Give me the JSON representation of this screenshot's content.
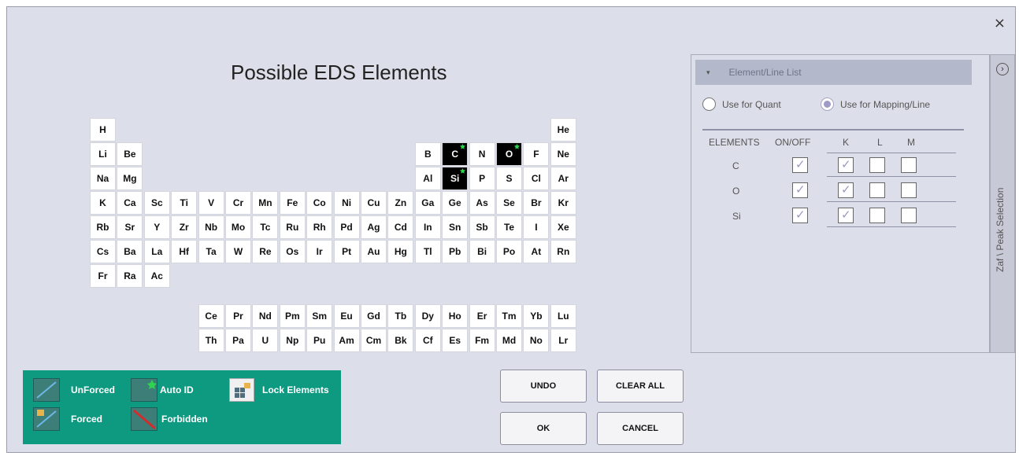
{
  "dialog": {
    "title": "Possible EDS Elements",
    "close_label": "×"
  },
  "periodic_table": {
    "rows": [
      [
        "H",
        "",
        "",
        "",
        "",
        "",
        "",
        "",
        "",
        "",
        "",
        "",
        "",
        "",
        "",
        "",
        "",
        "He"
      ],
      [
        "Li",
        "Be",
        "",
        "",
        "",
        "",
        "",
        "",
        "",
        "",
        "",
        "",
        "B",
        "C",
        "N",
        "O",
        "F",
        "Ne"
      ],
      [
        "Na",
        "Mg",
        "",
        "",
        "",
        "",
        "",
        "",
        "",
        "",
        "",
        "",
        "Al",
        "Si",
        "P",
        "S",
        "Cl",
        "Ar"
      ],
      [
        "K",
        "Ca",
        "Sc",
        "Ti",
        "V",
        "Cr",
        "Mn",
        "Fe",
        "Co",
        "Ni",
        "Cu",
        "Zn",
        "Ga",
        "Ge",
        "As",
        "Se",
        "Br",
        "Kr"
      ],
      [
        "Rb",
        "Sr",
        "Y",
        "Zr",
        "Nb",
        "Mo",
        "Tc",
        "Ru",
        "Rh",
        "Pd",
        "Ag",
        "Cd",
        "In",
        "Sn",
        "Sb",
        "Te",
        "I",
        "Xe"
      ],
      [
        "Cs",
        "Ba",
        "La",
        "Hf",
        "Ta",
        "W",
        "Re",
        "Os",
        "Ir",
        "Pt",
        "Au",
        "Hg",
        "Tl",
        "Pb",
        "Bi",
        "Po",
        "At",
        "Rn"
      ],
      [
        "Fr",
        "Ra",
        "Ac"
      ]
    ],
    "lanthanides": [
      "Ce",
      "Pr",
      "Nd",
      "Pm",
      "Sm",
      "Eu",
      "Gd",
      "Tb",
      "Dy",
      "Ho",
      "Er",
      "Tm",
      "Yb",
      "Lu"
    ],
    "actinides": [
      "Th",
      "Pa",
      "U",
      "Np",
      "Pu",
      "Am",
      "Cm",
      "Bk",
      "Cf",
      "Es",
      "Fm",
      "Md",
      "No",
      "Lr"
    ],
    "selected": [
      "C",
      "O",
      "Si"
    ],
    "auto_id": [
      "C",
      "O",
      "Si"
    ]
  },
  "legend": {
    "unforced": "UnForced",
    "forced": "Forced",
    "auto_id": "Auto ID",
    "forbidden": "Forbidden",
    "lock_elements": "Lock Elements"
  },
  "buttons": {
    "undo": "UNDO",
    "clear_all": "CLEAR ALL",
    "ok": "OK",
    "cancel": "CANCEL"
  },
  "panel": {
    "header": "Element/Line List",
    "use_for_quant": "Use for Quant",
    "use_for_mapping": "Use for Mapping/Line",
    "mode_selected": "Use for Mapping/Line",
    "columns": {
      "elements": "ELEMENTS",
      "on_off": "ON/OFF",
      "k": "K",
      "l": "L",
      "m": "M"
    },
    "elements": [
      {
        "name": "C",
        "on": true,
        "k": true,
        "l": false,
        "m": false
      },
      {
        "name": "O",
        "on": true,
        "k": true,
        "l": false,
        "m": false
      },
      {
        "name": "Si",
        "on": true,
        "k": true,
        "l": false,
        "m": false
      }
    ]
  },
  "side_tab": {
    "label": "Zaf \\ Peak Selection"
  },
  "colors": {
    "legend_bg": "#0e9a80",
    "auto_id_marker": "#2fd34f",
    "selected_cell": "#000000",
    "check": "#9c98c4"
  }
}
